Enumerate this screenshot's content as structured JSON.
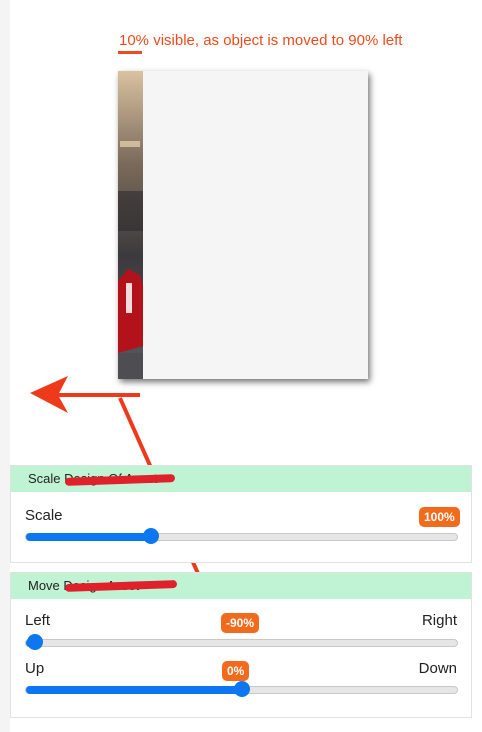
{
  "caption": "10% visible, as object is moved to 90% left",
  "scale_panel": {
    "title": "Scale Design Of Asset",
    "label": "Scale",
    "value_text": "100%",
    "fraction": 0.29
  },
  "move_panel": {
    "title": "Move Design Asset",
    "horizontal": {
      "left_label": "Left",
      "right_label": "Right",
      "value_text": "-90%",
      "fraction": 0.02
    },
    "vertical": {
      "up_label": "Up",
      "down_label": "Down",
      "value_text": "0%",
      "fraction": 0.5
    }
  },
  "colors": {
    "accent": "#0d77f2",
    "badge": "#f26b1d",
    "annotation": "#ee4a1c",
    "panel_header": "#bff3d3"
  },
  "icons": {
    "annotation_arrow": "arrow-left-icon",
    "annotation_pointer": "arrow-down-icon"
  }
}
